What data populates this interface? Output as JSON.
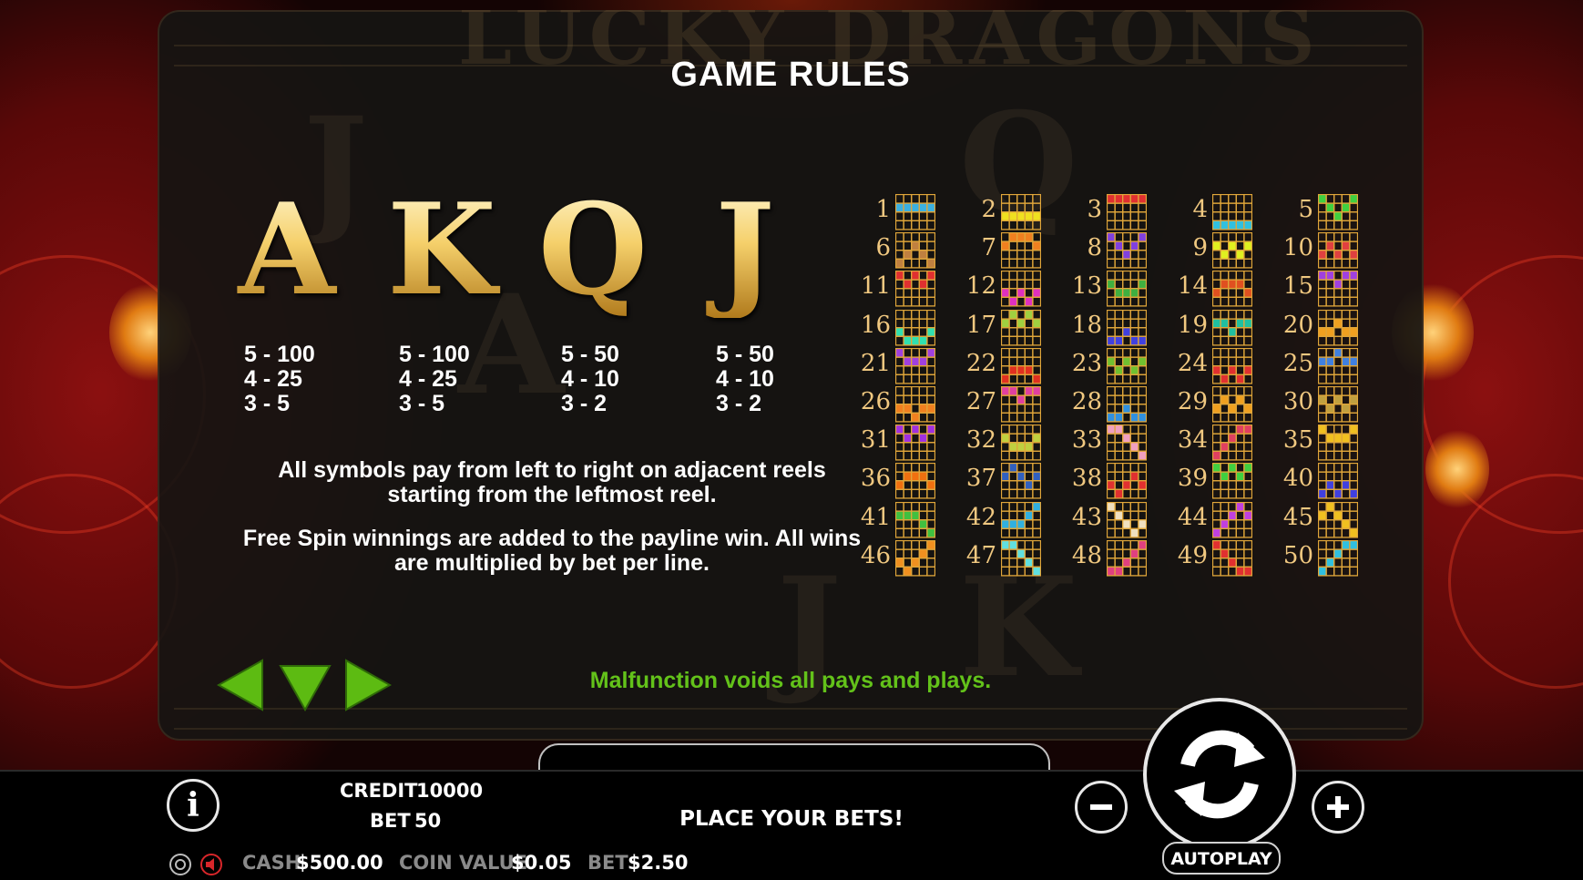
{
  "game_title": "LUCKY DRAGONS",
  "rules": {
    "title": "GAME RULES",
    "symbols": [
      {
        "glyph": "A",
        "pays": [
          "5 - 100",
          "4 - 25",
          "3 - 5"
        ]
      },
      {
        "glyph": "K",
        "pays": [
          "5 - 100",
          "4 - 25",
          "3 - 5"
        ]
      },
      {
        "glyph": "Q",
        "pays": [
          "5 - 50",
          "4 - 10",
          "3 - 2"
        ]
      },
      {
        "glyph": "J",
        "pays": [
          "5 - 50",
          "4 - 10",
          "3 - 2"
        ]
      }
    ],
    "text1": "All symbols pay from left to right on adjacent reels starting from the leftmost reel.",
    "text2": "Free Spin winnings are added to the payline win. All wins are multiplied by bet per line.",
    "paylines": [
      {
        "n": "1",
        "c": "#3bb0e0",
        "r": [
          1,
          1,
          1,
          1,
          1
        ]
      },
      {
        "n": "2",
        "c": "#f0e020",
        "r": [
          2,
          2,
          2,
          2,
          2
        ]
      },
      {
        "n": "3",
        "c": "#e03030",
        "r": [
          0,
          0,
          0,
          0,
          0
        ]
      },
      {
        "n": "4",
        "c": "#30c0e0",
        "r": [
          3,
          3,
          3,
          3,
          3
        ]
      },
      {
        "n": "5",
        "c": "#40d040",
        "r": [
          0,
          1,
          2,
          1,
          0
        ]
      },
      {
        "n": "6",
        "c": "#c08040",
        "r": [
          3,
          2,
          1,
          2,
          3
        ]
      },
      {
        "n": "7",
        "c": "#f08020",
        "r": [
          1,
          0,
          0,
          0,
          1
        ]
      },
      {
        "n": "8",
        "c": "#8040e0",
        "r": [
          0,
          1,
          2,
          1,
          0
        ]
      },
      {
        "n": "9",
        "c": "#e0f020",
        "r": [
          1,
          2,
          1,
          2,
          1
        ]
      },
      {
        "n": "10",
        "c": "#e04040",
        "r": [
          2,
          1,
          2,
          1,
          2
        ]
      },
      {
        "n": "11",
        "c": "#e03030",
        "r": [
          0,
          1,
          0,
          1,
          0
        ]
      },
      {
        "n": "12",
        "c": "#e030c0",
        "r": [
          2,
          3,
          2,
          3,
          2
        ]
      },
      {
        "n": "13",
        "c": "#40b040",
        "r": [
          1,
          2,
          2,
          2,
          1
        ]
      },
      {
        "n": "14",
        "c": "#e05020",
        "r": [
          2,
          1,
          1,
          1,
          2
        ]
      },
      {
        "n": "15",
        "c": "#a040e0",
        "r": [
          0,
          0,
          1,
          0,
          0
        ]
      },
      {
        "n": "16",
        "c": "#30e0b0",
        "r": [
          2,
          3,
          3,
          3,
          2
        ]
      },
      {
        "n": "17",
        "c": "#a0d040",
        "r": [
          1,
          0,
          1,
          0,
          1
        ]
      },
      {
        "n": "18",
        "c": "#4040e0",
        "r": [
          3,
          3,
          2,
          3,
          3
        ]
      },
      {
        "n": "19",
        "c": "#20c0a0",
        "r": [
          1,
          1,
          2,
          1,
          1
        ]
      },
      {
        "n": "20",
        "c": "#f0a020",
        "r": [
          2,
          2,
          1,
          2,
          2
        ]
      },
      {
        "n": "21",
        "c": "#a040e0",
        "r": [
          0,
          1,
          1,
          1,
          0
        ]
      },
      {
        "n": "22",
        "c": "#e03020",
        "r": [
          3,
          2,
          2,
          2,
          3
        ]
      },
      {
        "n": "23",
        "c": "#70c030",
        "r": [
          1,
          2,
          1,
          2,
          1
        ]
      },
      {
        "n": "24",
        "c": "#e03030",
        "r": [
          2,
          3,
          2,
          3,
          2
        ]
      },
      {
        "n": "25",
        "c": "#4080e0",
        "r": [
          1,
          1,
          0,
          1,
          1
        ]
      },
      {
        "n": "26",
        "c": "#f08020",
        "r": [
          2,
          2,
          3,
          2,
          2
        ]
      },
      {
        "n": "27",
        "c": "#e040a0",
        "r": [
          0,
          0,
          1,
          0,
          0
        ]
      },
      {
        "n": "28",
        "c": "#3090e0",
        "r": [
          3,
          3,
          2,
          3,
          3
        ]
      },
      {
        "n": "29",
        "c": "#f0a020",
        "r": [
          2,
          1,
          2,
          1,
          2
        ]
      },
      {
        "n": "30",
        "c": "#c0a040",
        "r": [
          1,
          2,
          1,
          2,
          1
        ]
      },
      {
        "n": "31",
        "c": "#a030e0",
        "r": [
          0,
          1,
          0,
          1,
          0
        ]
      },
      {
        "n": "32",
        "c": "#c0d040",
        "r": [
          1,
          2,
          2,
          2,
          1
        ]
      },
      {
        "n": "33",
        "c": "#f0a0c0",
        "r": [
          0,
          0,
          1,
          2,
          3
        ]
      },
      {
        "n": "34",
        "c": "#e04060",
        "r": [
          3,
          2,
          1,
          0,
          0
        ]
      },
      {
        "n": "35",
        "c": "#f0c020",
        "r": [
          0,
          1,
          1,
          1,
          0
        ]
      },
      {
        "n": "36",
        "c": "#f07010",
        "r": [
          2,
          1,
          1,
          1,
          2
        ]
      },
      {
        "n": "37",
        "c": "#3060c0",
        "r": [
          1,
          0,
          1,
          2,
          1
        ]
      },
      {
        "n": "38",
        "c": "#e03030",
        "r": [
          2,
          3,
          2,
          1,
          2
        ]
      },
      {
        "n": "39",
        "c": "#40d040",
        "r": [
          0,
          1,
          0,
          1,
          0
        ]
      },
      {
        "n": "40",
        "c": "#4040e0",
        "r": [
          3,
          2,
          3,
          2,
          3
        ]
      },
      {
        "n": "41",
        "c": "#40c040",
        "r": [
          1,
          1,
          1,
          2,
          3
        ]
      },
      {
        "n": "42",
        "c": "#30b0e0",
        "r": [
          2,
          2,
          2,
          1,
          0
        ]
      },
      {
        "n": "43",
        "c": "#f0e0c0",
        "r": [
          0,
          1,
          2,
          3,
          2
        ]
      },
      {
        "n": "44",
        "c": "#c040e0",
        "r": [
          3,
          2,
          1,
          0,
          1
        ]
      },
      {
        "n": "45",
        "c": "#f0c020",
        "r": [
          1,
          0,
          1,
          2,
          3
        ]
      },
      {
        "n": "46",
        "c": "#f09020",
        "r": [
          2,
          3,
          2,
          1,
          0
        ]
      },
      {
        "n": "47",
        "c": "#60e0e0",
        "r": [
          0,
          0,
          1,
          2,
          3
        ]
      },
      {
        "n": "48",
        "c": "#e04080",
        "r": [
          3,
          3,
          2,
          1,
          0
        ]
      },
      {
        "n": "49",
        "c": "#e03030",
        "r": [
          0,
          1,
          2,
          3,
          3
        ]
      },
      {
        "n": "50",
        "c": "#30c0e0",
        "r": [
          3,
          2,
          1,
          0,
          0
        ]
      }
    ],
    "footer": "Malfunction voids all pays and plays.",
    "page_dots": 3
  },
  "hud": {
    "credit_label": "CREDIT",
    "credit_value": "10000",
    "bet_label": "BET",
    "bet_value": "50",
    "message": "PLACE YOUR BETS!",
    "cash_label": "CASH",
    "cash_value": "$500.00",
    "coin_value_label": "COIN VALUE",
    "coin_value": "$0.05",
    "bet2_label": "BET",
    "bet2_value": "$2.50",
    "autoplay_label": "AUTOPLAY"
  },
  "colors": {
    "accent_green": "#5dbb12",
    "footer_green": "#63c21a",
    "gold": "#f5d06b",
    "payline_grid": "#e0a63a"
  },
  "icons": {
    "info": "info-icon",
    "settings": "gear-icon",
    "sound": "speaker-icon",
    "prev": "arrow-left-icon",
    "close": "arrow-down-icon",
    "next": "arrow-right-icon",
    "minus": "minus-icon",
    "plus": "plus-icon",
    "spin": "spin-arrows-icon"
  }
}
